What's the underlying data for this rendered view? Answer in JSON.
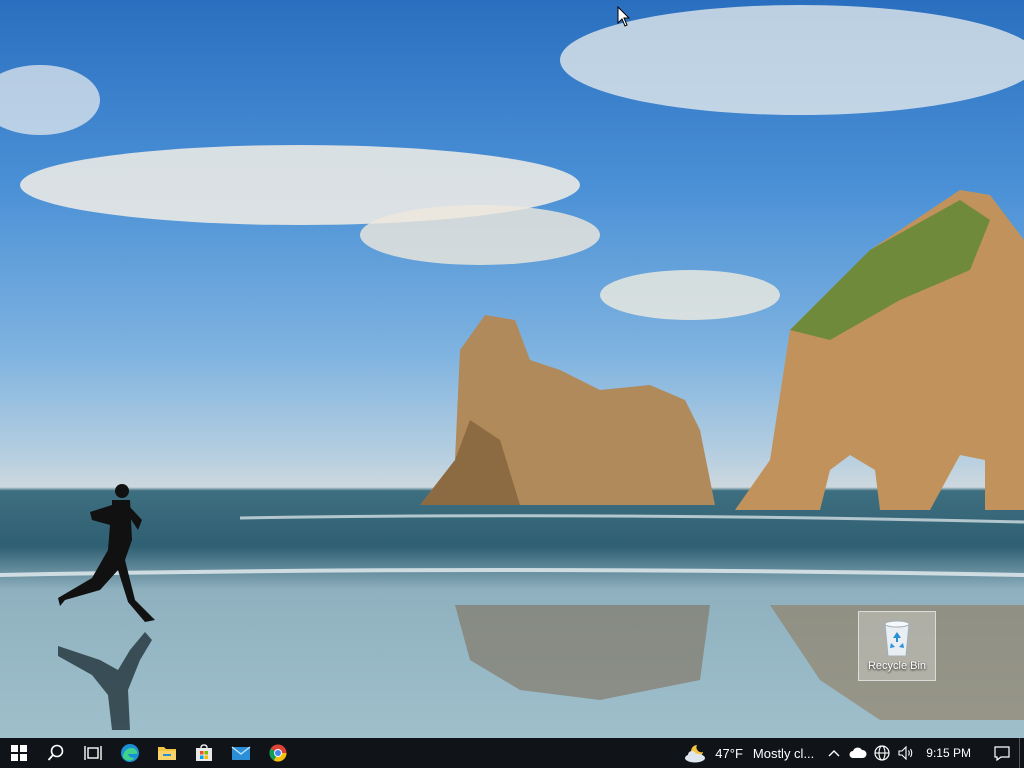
{
  "desktop": {
    "icons": [
      {
        "label": "Recycle Bin",
        "icon": "recycle-bin-icon"
      }
    ]
  },
  "taskbar": {
    "pinned": [
      {
        "name": "start",
        "icon": "windows-logo-icon"
      },
      {
        "name": "search",
        "icon": "search-icon"
      },
      {
        "name": "task-view",
        "icon": "task-view-icon"
      },
      {
        "name": "edge",
        "icon": "edge-icon"
      },
      {
        "name": "file-explorer",
        "icon": "folder-icon"
      },
      {
        "name": "store",
        "icon": "store-icon"
      },
      {
        "name": "mail",
        "icon": "mail-icon"
      },
      {
        "name": "chrome",
        "icon": "chrome-icon"
      }
    ],
    "weather": {
      "temperature": "47°F",
      "condition": "Mostly cl..."
    },
    "clock": "9:15 PM",
    "colors": {
      "background": "#101418",
      "accent": "#0078d7"
    }
  }
}
